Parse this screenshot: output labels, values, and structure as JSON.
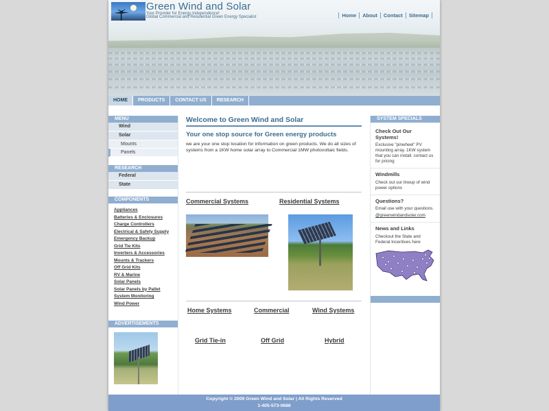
{
  "header": {
    "site_title": "Green Wind and Solar",
    "tagline_1": "Your Provider for Energy Independence!",
    "tagline_2": "Global Commercial and Residential Green Energy Specialist",
    "top_links": [
      "Home",
      "About",
      "Contact",
      "Sitemap"
    ]
  },
  "nav": {
    "tabs": [
      "HOME",
      "PRODUCTS",
      "CONTACT US",
      "RESEARCH"
    ],
    "active": "HOME"
  },
  "left": {
    "menu_title": "MENU",
    "menu_items": [
      "Wind",
      "Solar"
    ],
    "solar_subitems": [
      "Mounts",
      "Panels"
    ],
    "research_title": "RESEARCH",
    "research_items": [
      "Federal",
      "State"
    ],
    "components_title": "COMPONENTS",
    "components": [
      "Appliances",
      "Batteries & Enclosures",
      "Charge Controllers",
      "Electrical & Safety Supply",
      "Emergency Backup",
      "Grid Tie Kits",
      "Inverters & Accessories",
      "Mounts & Trackers",
      "Off Grid Kits",
      "RV & Marine",
      "Solar Panels",
      "Solar Panels by Pallet",
      "System Monitoring",
      "Wind Power"
    ],
    "ads_title": "ADVERTISEMENTS"
  },
  "center": {
    "welcome": "Welcome to Green Wind and Solar",
    "subtitle": "Your one stop source for Green energy products",
    "intro": "we are your one stop location for information on green products. We do all sizes of systems from a 1KW home solar array to Commercial 1MW photovoltaic fields.",
    "commercial_systems": "Commercial Systems",
    "residential_systems": "Residential Systems",
    "categories_row1": [
      "Home Systems",
      "Commercial",
      "Wind Systems"
    ],
    "categories_row2": [
      "Grid Tie-in",
      "Off Grid",
      "Hybrid"
    ]
  },
  "right": {
    "title": "SYSTEM SPECIALS",
    "special_1_title": "Check Out Our Systems!",
    "special_1_text": "Exclusive \"pinwheel\" PV mounting array. 1KW system that you can install. contact us for pricing",
    "windmills_title": "Windmills",
    "windmills_text": "Check out our lineup of wind power options",
    "questions_title": "Questions?",
    "questions_text": "Email use with your questions.",
    "questions_email": "@greenwindandsolar.com",
    "news_title": "News and Links",
    "news_text": "Checkout the State and Federal Incentives here"
  },
  "footer": {
    "copyright": "Copyright © 2009 Green Wind and Solar | All Rights Reserved",
    "phone": "1-405-573-0686"
  },
  "colors": {
    "accent_blue": "#8faed0",
    "title_blue": "#3c6c8f",
    "footer_blue": "#7f9ecb"
  }
}
